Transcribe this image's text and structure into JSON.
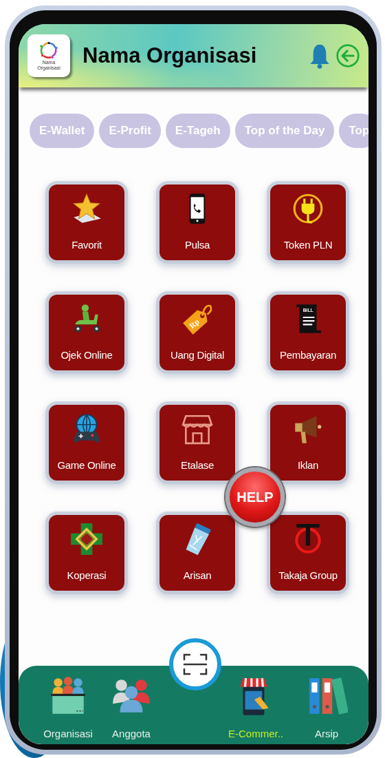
{
  "header": {
    "logo_text": "Nama Organisasi",
    "title": "Nama Organisasi"
  },
  "chips": [
    {
      "label": "E-Wallet"
    },
    {
      "label": "E-Profit"
    },
    {
      "label": "E-Tageh"
    },
    {
      "label": "Top of the Day"
    },
    {
      "label": "Top"
    }
  ],
  "menu": [
    {
      "label": "Favorit"
    },
    {
      "label": "Pulsa"
    },
    {
      "label": "Token PLN"
    },
    {
      "label": "Ojek Online"
    },
    {
      "label": "Uang Digital"
    },
    {
      "label": "Pembayaran"
    },
    {
      "label": "Game Online"
    },
    {
      "label": "Etalase"
    },
    {
      "label": "Iklan"
    },
    {
      "label": "Koperasi"
    },
    {
      "label": "Arisan"
    },
    {
      "label": "Takaja Group"
    }
  ],
  "menu_icon_texts": [
    "Rp",
    "BILL"
  ],
  "help_button": {
    "label": "HELP"
  },
  "bottom_nav": [
    {
      "label": "Organisasi",
      "selected": false
    },
    {
      "label": "Anggota",
      "selected": false
    },
    {
      "label": "E-Commer..",
      "selected": true
    },
    {
      "label": "Arsip",
      "selected": false
    }
  ]
}
